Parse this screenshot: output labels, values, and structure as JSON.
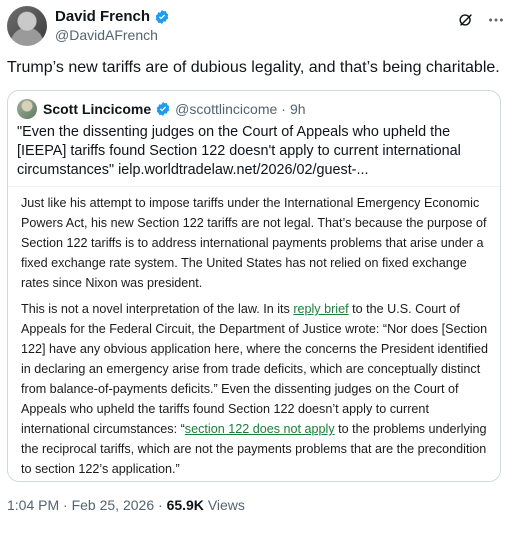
{
  "author": {
    "display_name": "David French",
    "handle": "@DavidAFrench"
  },
  "icons": {
    "verified": "verified-badge-icon",
    "grok": "grok-icon",
    "more": "more-icon"
  },
  "colors": {
    "verified_blue": "#1d9bf0",
    "link_green": "#1a7f3c"
  },
  "tweet": {
    "text": "Trump’s new tariffs are of dubious legality, and that’s being charitable."
  },
  "quote": {
    "display_name": "Scott Lincicome",
    "handle": "@scottlincicome",
    "separator": "·",
    "time": "9h",
    "text": "\"Even the dissenting judges on the Court of Appeals who upheld the [IEEPA] tariffs found Section 122 doesn't apply to current international circumstances\"",
    "link": "ielp.worldtradelaw.net/2026/02/guest-...",
    "image": {
      "para1": "Just like his attempt to impose tariffs under the International Emergency Economic Powers Act, his new Section 122 tariffs are not legal. That’s because the purpose of Section 122 tariffs is to address international payments problems that arise under a fixed exchange rate system. The United States has not relied on fixed exchange rates since Nixon was president.",
      "p2_a": "This is not a novel interpretation of the law. In its ",
      "p2_link1": "reply brief",
      "p2_b": " to the U.S. Court of Appeals for the Federal Circuit, the Department of Justice wrote: “Nor does [Section 122] have any obvious application here, where the concerns the President identified in declaring an emergency arise  from trade deficits, which are conceptually distinct from balance-of-payments deficits.” Even the dissenting judges on the Court of Appeals who upheld the tariffs found Section 122 doesn’t apply to current international circumstances: “",
      "p2_link2": "section 122 does not apply",
      "p2_c": " to the problems underlying the reciprocal tariffs, which are not the payments problems that are the precondition to section 122’s application.”"
    }
  },
  "footer": {
    "time": "1:04 PM",
    "sep": "·",
    "date": "Feb 25, 2026",
    "sep2": "·",
    "views_count": "65.9K",
    "views_label": "Views"
  }
}
